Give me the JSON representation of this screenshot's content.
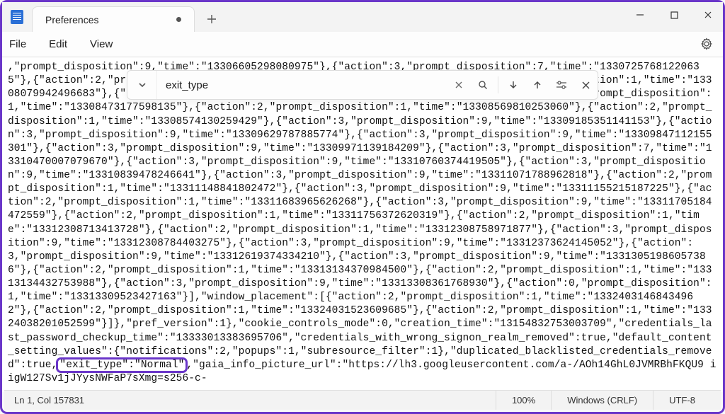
{
  "window": {
    "tab_title": "Preferences",
    "tab_modified": true
  },
  "menu": {
    "file": "File",
    "edit": "Edit",
    "view": "View"
  },
  "find": {
    "value": "exit_type"
  },
  "editor": {
    "text_pre_highlight": ",\"prompt_disposition\":9,\"time\":\"13306605298080975\"},{\"action\":3,\"prompt_disposition\":7,\"time\":\"13307257681220635\"},{\"action\":2,\"prompt_disposition\":1,\"time\":\"13307631518255406\"},{\"action\":2,\"prompt_disposition\":1,\"time\":\"13308079942496683\"},{\"action\":2,\"prompt_disposition\":1,\"time\":\"13308463060350559\"},{\"action\":2,\"prompt_disposition\":1,\"time\":\"13308473177598135\"},{\"action\":2,\"prompt_disposition\":1,\"time\":\"13308569810253060\"},{\"action\":2,\"prompt_disposition\":1,\"time\":\"13308574130259429\"},{\"action\":3,\"prompt_disposition\":9,\"time\":\"13309185351141153\"},{\"action\":3,\"prompt_disposition\":9,\"time\":\"13309629787885774\"},{\"action\":3,\"prompt_disposition\":9,\"time\":\"13309847112155301\"},{\"action\":3,\"prompt_disposition\":9,\"time\":\"13309971139184209\"},{\"action\":3,\"prompt_disposition\":7,\"time\":\"13310470007079670\"},{\"action\":3,\"prompt_disposition\":9,\"time\":\"13310760374419505\"},{\"action\":3,\"prompt_disposition\":9,\"time\":\"13310839478246641\"},{\"action\":3,\"prompt_disposition\":9,\"time\":\"13311071788962818\"},{\"action\":2,\"prompt_disposition\":1,\"time\":\"13311148841802472\"},{\"action\":3,\"prompt_disposition\":9,\"time\":\"13311155215187225\"},{\"action\":2,\"prompt_disposition\":1,\"time\":\"13311683965626268\"},{\"action\":3,\"prompt_disposition\":9,\"time\":\"13311705184472559\"},{\"action\":2,\"prompt_disposition\":1,\"time\":\"13311756372620319\"},{\"action\":2,\"prompt_disposition\":1,\"time\":\"13312308713413728\"},{\"action\":2,\"prompt_disposition\":1,\"time\":\"13312308758971877\"},{\"action\":3,\"prompt_disposition\":9,\"time\":\"13312308784403275\"},{\"action\":3,\"prompt_disposition\":9,\"time\":\"13312373624145052\"},{\"action\":3,\"prompt_disposition\":9,\"time\":\"13312619374334210\"},{\"action\":3,\"prompt_disposition\":9,\"time\":\"13313051986057386\"},{\"action\":2,\"prompt_disposition\":1,\"time\":\"13313134370984500\"},{\"action\":2,\"prompt_disposition\":1,\"time\":\"13313134432753988\"},{\"action\":3,\"prompt_disposition\":9,\"time\":\"13313308361768930\"},{\"action\":0,\"prompt_disposition\":1,\"time\":\"13313309523427163\"}],\"window_placement\":[{\"action\":2,\"prompt_disposition\":1,\"time\":\"13324031468434962\"},{\"action\":2,\"prompt_disposition\":1,\"time\":\"13324031523609685\"},{\"action\":2,\"prompt_disposition\":1,\"time\":\"13324038201052599\"}]},\"pref_version\":1},\"cookie_controls_mode\":0,\"creation_time\":\"13154832753003709\",\"credentials_last_password_checkup_time\":\"13333013383695706\",\"credentials_with_wrong_signon_realm_removed\":true,\"default_content_setting_values\":{\"notifications\":2,\"popups\":1,\"subresource_filter\":1},\"duplicated_blacklisted_credentials_removed\":true,",
    "highlight_text": "\"exit_type\":\"Normal\"",
    "text_post_highlight": ",\"gaia_info_picture_url\":\"https://lh3.googleusercontent.com/a-/AOh14GhL0JVMRBhFKQU9 iigW127Sv1jJYysNWFaP7sXmg=s256-c-"
  },
  "status": {
    "position": "Ln 1, Col 157831",
    "zoom": "100%",
    "eol": "Windows (CRLF)",
    "encoding": "UTF-8"
  }
}
